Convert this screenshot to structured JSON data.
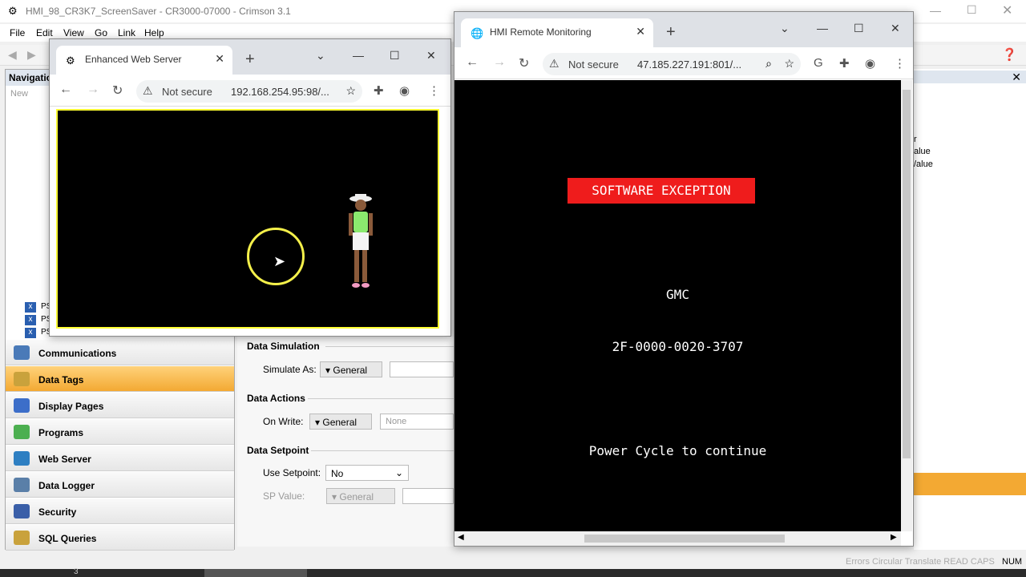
{
  "app": {
    "title": "HMI_98_CR3K7_ScreenSaver - CR3000-07000 - Crimson 3.1",
    "menu": [
      "File",
      "Edit",
      "View",
      "Go",
      "Link",
      "Help"
    ],
    "nav_title": "Navigation",
    "nav_new": "New",
    "nav_items": [
      {
        "label": "Communications",
        "icon": "communications-icon",
        "color": "#4a7ab8"
      },
      {
        "label": "Data Tags",
        "icon": "data-tags-icon",
        "color": "#c9a23c"
      },
      {
        "label": "Display Pages",
        "icon": "display-pages-icon",
        "color": "#3c6ec9"
      },
      {
        "label": "Programs",
        "icon": "programs-icon",
        "color": "#4caf50"
      },
      {
        "label": "Web Server",
        "icon": "web-server-icon",
        "color": "#2e7fc2"
      },
      {
        "label": "Data Logger",
        "icon": "data-logger-icon",
        "color": "#5a7fa8"
      },
      {
        "label": "Security",
        "icon": "security-icon",
        "color": "#3a5fa8"
      },
      {
        "label": "SQL Queries",
        "icon": "sql-queries-icon",
        "color": "#c9a23c"
      }
    ],
    "tree_labels": [
      "PS",
      "PS",
      "PS"
    ],
    "props": {
      "data_simulation": "Data Simulation",
      "simulate_as_label": "Simulate As:",
      "simulate_as_value": "General",
      "data_actions": "Data Actions",
      "on_write_label": "On Write:",
      "on_write_value": "General",
      "on_write_input": "None",
      "data_setpoint": "Data Setpoint",
      "use_setpoint_label": "Use Setpoint:",
      "use_setpoint_value": "No",
      "sp_value_label": "SP Value:",
      "sp_value_value": "General"
    },
    "right_pane": [
      "r",
      "alue",
      "/alue"
    ],
    "status": "Errors  Circular  Translate  READ  CAPS",
    "status_num": "NUM",
    "taskbar_item": "3"
  },
  "web_server": {
    "tab_title": "Enhanced Web Server",
    "not_secure": "Not secure",
    "url": "192.168.254.95:98/..."
  },
  "hmi": {
    "tab_title": "HMI Remote Monitoring",
    "not_secure": "Not secure",
    "url": "47.185.227.191:801/...",
    "exception": "SOFTWARE EXCEPTION",
    "vendor": "GMC",
    "code": "2F-0000-0020-3707",
    "message": "Power Cycle to continue"
  },
  "colors": {
    "exception_bg": "#ef1c1c",
    "highlight": "#f3a933",
    "screen_border": "#ffff33"
  }
}
